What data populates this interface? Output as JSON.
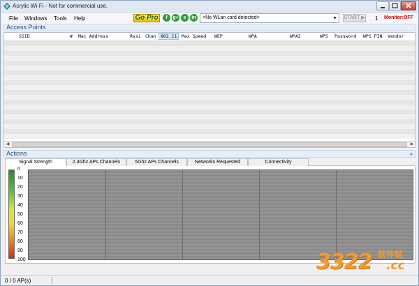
{
  "window": {
    "title": "Acrylic Wi-Fi - Not for commercial use."
  },
  "menu": [
    "File",
    "Windows",
    "Tools",
    "Help"
  ],
  "toolbar": {
    "gopro_label": "Go Pro",
    "social": [
      {
        "icon": "facebook-icon",
        "glyph": "f"
      },
      {
        "icon": "google-plus-icon",
        "glyph": "g+"
      },
      {
        "icon": "skype-icon",
        "glyph": "s"
      },
      {
        "icon": "linkedin-icon",
        "glyph": "in"
      }
    ],
    "wlan_value": "<No WLan card detected>",
    "start_label": "START ▶",
    "count": "1",
    "monitor": "Monitor:OFF"
  },
  "access_points": {
    "header": "Access Points",
    "columns": [
      "SSID",
      "#",
      "Mac Address",
      "Rssi",
      "Chan",
      "802.11",
      "Max Speed",
      "WEP",
      "WPA",
      "WPA2",
      "WPS",
      "Password",
      "WPS PIN",
      "Vendor"
    ],
    "highlighted_column": "802.11"
  },
  "actions": {
    "header": "Actions",
    "tabs": [
      "Signal Strength",
      "2.4Ghz APs Channels",
      "5Ghz APs Channels",
      "Networks Requested",
      "Connectivity"
    ],
    "active_tab": "Signal Strength"
  },
  "signal_scale": [
    "0",
    "10",
    "20",
    "30",
    "40",
    "50",
    "60",
    "70",
    "80",
    "90",
    "100"
  ],
  "status": {
    "ap_count": "0 / 0 AP(s)"
  },
  "watermark": {
    "number": "3322",
    "cn": "软件站",
    "domain": ".cc"
  },
  "colors": {
    "accent": "#1c4f8f",
    "monitor_off": "#cc0000",
    "gopro_bg": "#f5d800",
    "social": "#2f9e33",
    "watermark": "#f39a2c"
  }
}
